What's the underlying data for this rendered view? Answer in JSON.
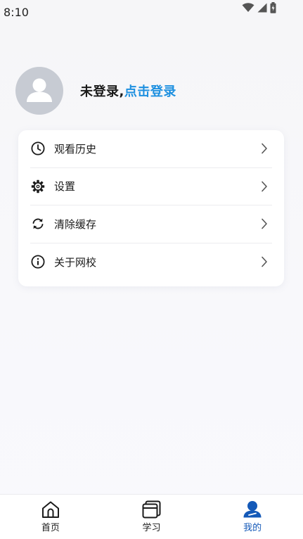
{
  "status_bar": {
    "time": "8:10"
  },
  "profile": {
    "status_text": "未登录,",
    "login_link": "点击登录",
    "link_color": "#1e90e0"
  },
  "menu": {
    "items": [
      {
        "label": "观看历史",
        "icon": "clock-icon"
      },
      {
        "label": "设置",
        "icon": "gear-icon"
      },
      {
        "label": "清除缓存",
        "icon": "refresh-icon"
      },
      {
        "label": "关于网校",
        "icon": "info-icon"
      }
    ]
  },
  "bottom_nav": {
    "items": [
      {
        "label": "首页",
        "icon": "home-icon",
        "active": false
      },
      {
        "label": "学习",
        "icon": "book-icon",
        "active": false
      },
      {
        "label": "我的",
        "icon": "profile-icon",
        "active": true
      }
    ],
    "active_color": "#1459b8"
  }
}
